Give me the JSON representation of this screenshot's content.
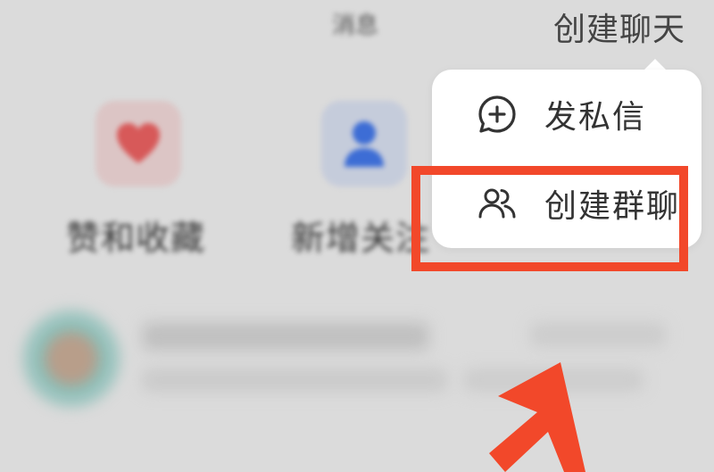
{
  "header": {
    "title": "消息",
    "action_label": "创建聊天"
  },
  "quick_actions": [
    {
      "label": "赞和收藏",
      "icon": "heart-icon",
      "color": "#e25a5a"
    },
    {
      "label": "新增关注",
      "icon": "person-icon",
      "color": "#3b6fe0"
    }
  ],
  "popup_menu": {
    "items": [
      {
        "label": "发私信",
        "icon": "chat-plus-icon"
      },
      {
        "label": "创建群聊",
        "icon": "group-icon"
      }
    ]
  },
  "annotations": {
    "highlight_color": "#f2482a",
    "pointer_icon": "arrow-pointer-icon"
  }
}
